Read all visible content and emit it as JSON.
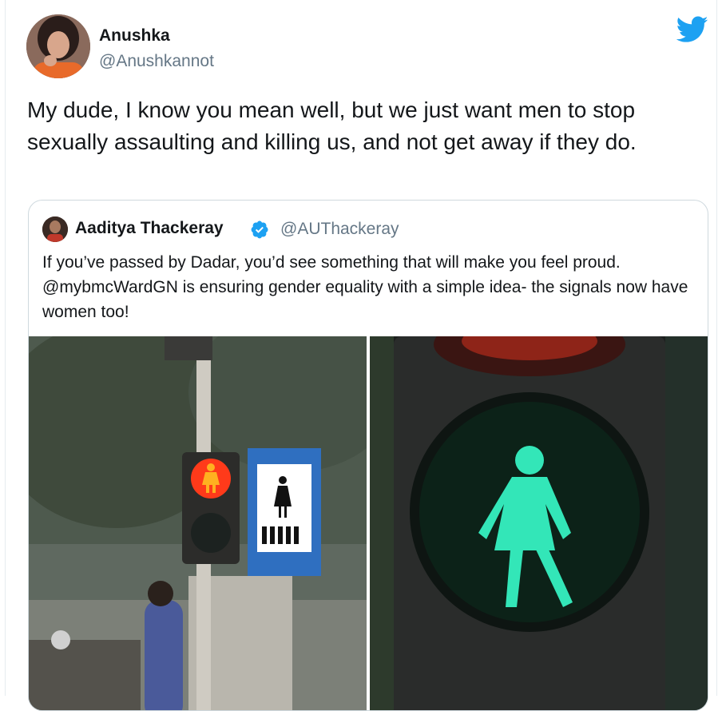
{
  "tweet": {
    "author_name": "Anushka",
    "author_handle": "@Anushkannot",
    "text": "My dude, I know you mean well, but we just want men to stop sexually assaulting and killing us, and not get away if they do."
  },
  "quoted_tweet": {
    "author_name": "Aaditya Thackeray",
    "author_handle": "@AUThackeray",
    "verified": true,
    "text": "If you’ve passed by Dadar, you’d see something that will make you feel proud. @mybmcWardGN is ensuring gender equality with a simple idea- the signals now have women too!",
    "photos": [
      {
        "icon": "street-photo-red-signal"
      },
      {
        "icon": "closeup-green-signal"
      }
    ]
  },
  "colors": {
    "twitter_blue": "#1da1f2",
    "text_primary": "#14171a",
    "text_secondary": "#657786",
    "border": "#cfd9de",
    "signal_red": "#ff3a1a",
    "signal_green": "#33e6b8"
  }
}
